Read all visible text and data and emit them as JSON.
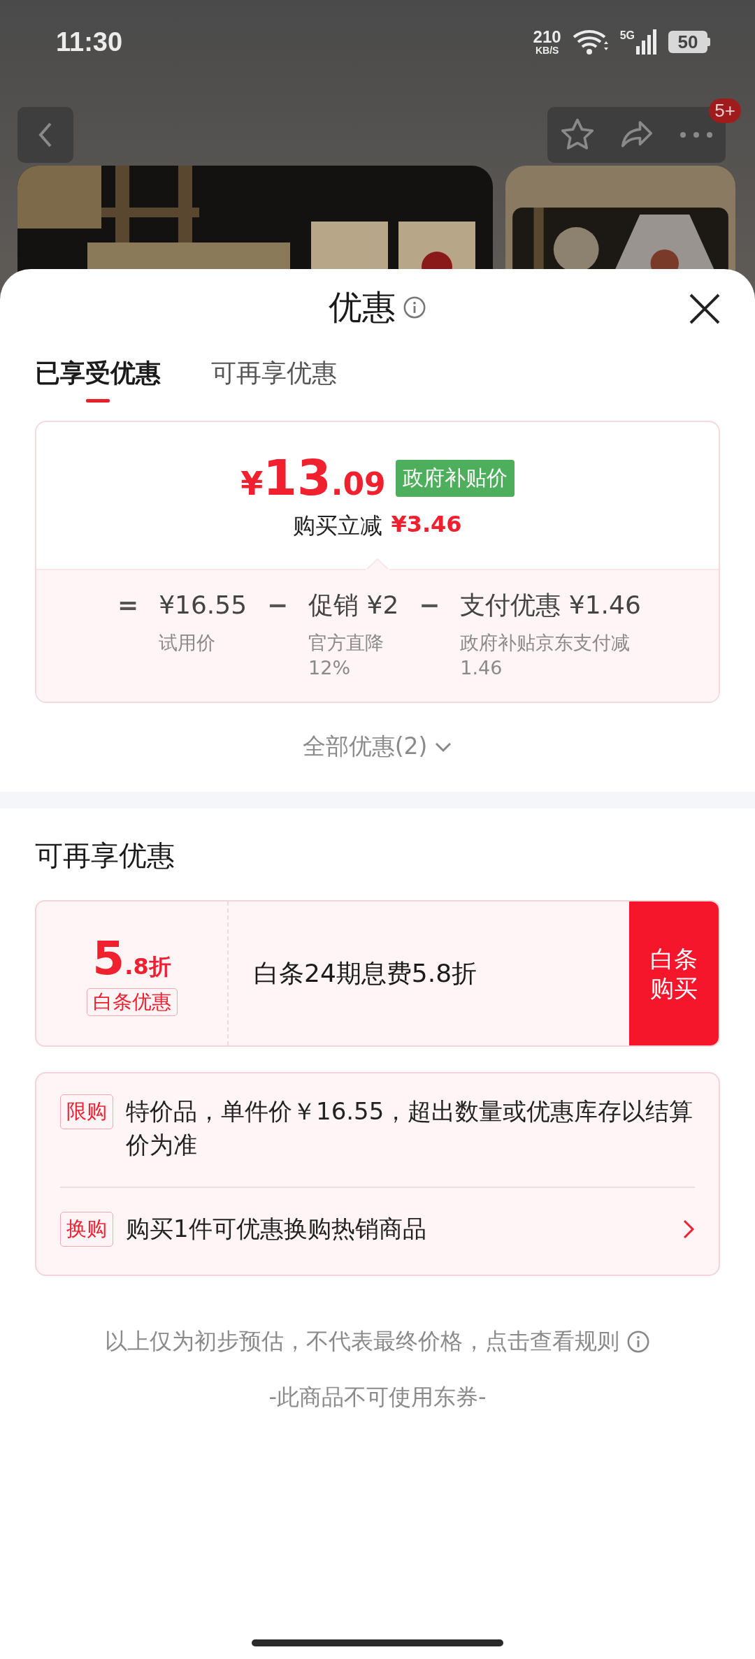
{
  "status_bar": {
    "time": "11:30",
    "net_speed": "210",
    "net_unit": "KB/S",
    "network": "5G",
    "battery": "50"
  },
  "nav": {
    "badge": "5+"
  },
  "sheet": {
    "title": "优惠",
    "tabs": [
      {
        "label": "已享受优惠",
        "selected": true
      },
      {
        "label": "可再享优惠",
        "selected": false
      }
    ],
    "price": {
      "currency": "¥",
      "integer": "13",
      "decimal": ".09",
      "badge": "政府补贴价",
      "saving_label": "购买立减",
      "saving": "¥3.46"
    },
    "breakdown": [
      {
        "op": "=",
        "value": "¥16.55",
        "note": "试用价"
      },
      {
        "op": "−",
        "value": "促销 ¥2",
        "note": "官方直降12%"
      },
      {
        "op": "−",
        "value": "支付优惠 ¥1.46",
        "note": "政府补贴京东支付减1.46"
      }
    ],
    "all_offers": "全部优惠(2)",
    "more_title": "可再享优惠",
    "coupon": {
      "value_main": "5",
      "value_sub": ".8折",
      "tag": "白条优惠",
      "description": "白条24期息费5.8折",
      "action": "白条购买"
    },
    "notices": [
      {
        "tag": "限购",
        "text": "特价品，单件价￥16.55，超出数量或优惠库存以结算价为准",
        "chevron": false
      },
      {
        "tag": "换购",
        "text": "购买1件可优惠换购热销商品",
        "chevron": true
      }
    ],
    "footer_rule": "以上仅为初步预估，不代表最终价格，点击查看规则",
    "footer_note": "-此商品不可使用东券-"
  }
}
